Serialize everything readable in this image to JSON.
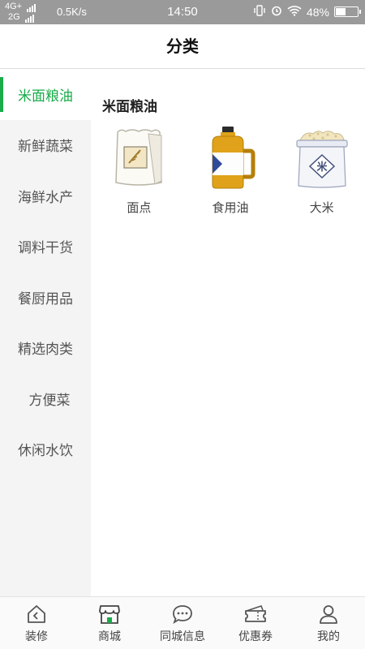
{
  "status_bar": {
    "network_top": "4G+",
    "network_bottom": "2G",
    "speed": "0.5K/s",
    "time": "14:50",
    "battery": "48%",
    "battery_level": 0.48
  },
  "header": {
    "title": "分类"
  },
  "sidebar": {
    "items": [
      {
        "label": "米面粮油"
      },
      {
        "label": "新鲜蔬菜"
      },
      {
        "label": "海鲜水产"
      },
      {
        "label": "调料干货"
      },
      {
        "label": "餐厨用品"
      },
      {
        "label": "精选肉类"
      },
      {
        "label": "方便菜"
      },
      {
        "label": "休闲水饮"
      }
    ],
    "active_index": 0
  },
  "main": {
    "section_title": "米面粮油",
    "products": [
      {
        "label": "面点",
        "icon": "flour-bag-icon"
      },
      {
        "label": "食用油",
        "icon": "oil-bottle-icon"
      },
      {
        "label": "大米",
        "icon": "rice-sack-icon"
      }
    ]
  },
  "tabbar": {
    "tabs": [
      {
        "label": "装修",
        "icon": "house-icon"
      },
      {
        "label": "商城",
        "icon": "store-icon"
      },
      {
        "label": "同城信息",
        "icon": "chat-bubble-icon"
      },
      {
        "label": "优惠券",
        "icon": "coupon-icon"
      },
      {
        "label": "我的",
        "icon": "user-icon"
      }
    ]
  },
  "colors": {
    "accent": "#1aab4a",
    "status_bar": "#9a9a9a",
    "sidebar_bg": "#f4f4f4"
  }
}
